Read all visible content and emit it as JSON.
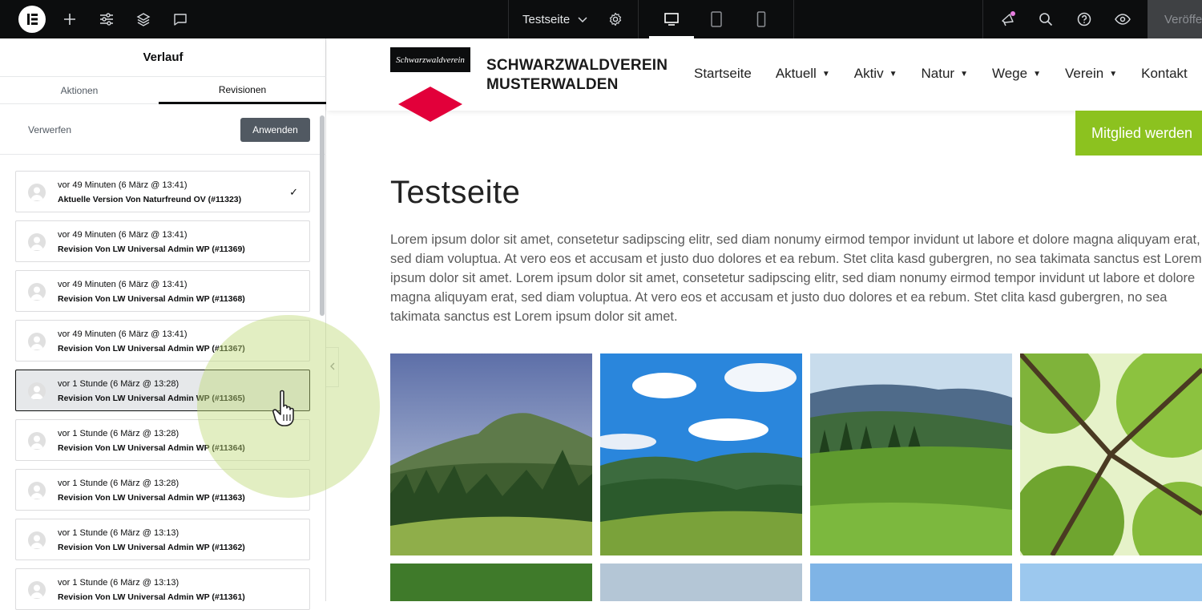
{
  "topbar": {
    "page_name": "Testseite",
    "publish_label": "Veröffentlichen"
  },
  "panel": {
    "title": "Verlauf",
    "tabs": [
      "Aktionen",
      "Revisionen"
    ],
    "discard_label": "Verwerfen",
    "apply_label": "Anwenden",
    "revisions": [
      {
        "time": "vor 49 Minuten (6 März @ 13:41)",
        "author": "Aktuelle Version Von Naturfreund OV (#11323)"
      },
      {
        "time": "vor 49 Minuten (6 März @ 13:41)",
        "author": "Revision Von LW Universal Admin WP (#11369)"
      },
      {
        "time": "vor 49 Minuten (6 März @ 13:41)",
        "author": "Revision Von LW Universal Admin WP (#11368)"
      },
      {
        "time": "vor 49 Minuten (6 März @ 13:41)",
        "author": "Revision Von LW Universal Admin WP (#11367)"
      },
      {
        "time": "vor 1 Stunde (6 März @ 13:28)",
        "author": "Revision Von LW Universal Admin WP (#11365)"
      },
      {
        "time": "vor 1 Stunde (6 März @ 13:28)",
        "author": "Revision Von LW Universal Admin WP (#11364)"
      },
      {
        "time": "vor 1 Stunde (6 März @ 13:28)",
        "author": "Revision Von LW Universal Admin WP (#11363)"
      },
      {
        "time": "vor 1 Stunde (6 März @ 13:13)",
        "author": "Revision Von LW Universal Admin WP (#11362)"
      },
      {
        "time": "vor 1 Stunde (6 März @ 13:13)",
        "author": "Revision Von LW Universal Admin WP (#11361)"
      }
    ]
  },
  "site": {
    "logo_text": "Schwarzwaldverein",
    "name_line1": "SCHWARZWALDVEREIN",
    "name_line2": "MUSTERWALDEN",
    "nav": [
      "Startseite",
      "Aktuell",
      "Aktiv",
      "Natur",
      "Wege",
      "Verein",
      "Kontakt"
    ],
    "member_button": "Mitglied werden",
    "page_title": "Testseite",
    "body_text": "Lorem ipsum dolor sit amet, consetetur sadipscing elitr, sed diam nonumy eirmod tempor invidunt ut labore et dolore magna aliquyam erat, sed diam voluptua. At vero eos et accusam et justo duo dolores et ea rebum. Stet clita kasd gubergren, no sea takimata sanctus est Lorem ipsum dolor sit amet. Lorem ipsum dolor sit amet, consetetur sadipscing elitr, sed diam nonumy eirmod tempor invidunt ut labore et dolore magna aliquyam erat, sed diam voluptua. At vero eos et accusam et justo duo dolores et ea rebum. Stet clita kasd gubergren, no sea takimata sanctus est Lorem ipsum dolor sit amet."
  },
  "colors": {
    "topbar_bg": "#0c0d0e",
    "accent_green": "#8cc21f",
    "logo_red": "#e2003a",
    "apply_bg": "#515962"
  }
}
